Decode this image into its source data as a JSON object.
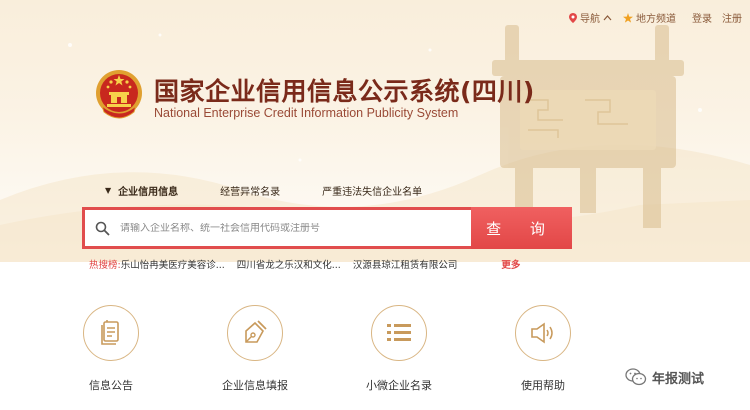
{
  "topbar": {
    "nav_label": "导航",
    "region_label": "地方频道",
    "login_label": "登录",
    "register_label": "注册"
  },
  "header": {
    "title_cn": "国家企业信用信息公示系统(四川)",
    "title_en": "National Enterprise Credit Information Publicity System"
  },
  "tabs": [
    {
      "label": "企业信用信息",
      "active": true
    },
    {
      "label": "经营异常名录",
      "active": false
    },
    {
      "label": "严重违法失信企业名单",
      "active": false
    }
  ],
  "search": {
    "placeholder": "请输入企业名称、统一社会信用代码或注册号",
    "button_label": "查 询"
  },
  "hot_search": {
    "label": "热搜榜:",
    "items": [
      "乐山怡冉美医疗美容诊...",
      "四川省龙之乐汉和文化...",
      "汉源县琼江租赁有限公司"
    ],
    "more_label": "更多"
  },
  "services": [
    {
      "label": "信息公告",
      "icon": "document-icon"
    },
    {
      "label": "企业信息填报",
      "icon": "pen-nib-icon"
    },
    {
      "label": "小微企业名录",
      "icon": "list-icon"
    },
    {
      "label": "使用帮助",
      "icon": "megaphone-icon"
    }
  ],
  "watermark": {
    "text": "年报测试"
  },
  "colors": {
    "accent_red": "#e24747",
    "title_brown": "#7a2a1a",
    "icon_gold": "#c89a5c",
    "hero_bg": "#f9eedb"
  }
}
